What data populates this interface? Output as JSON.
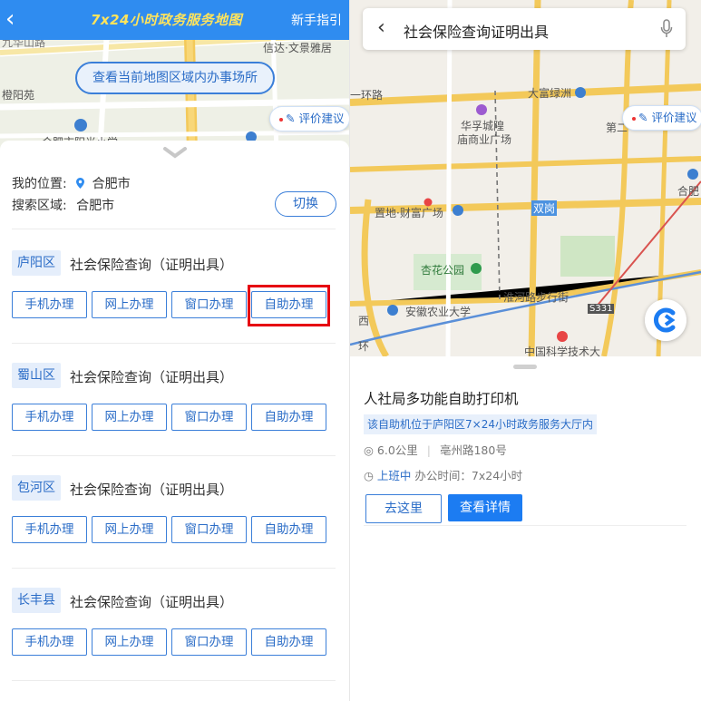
{
  "left": {
    "header": {
      "title": "7x24小时政务服务地图",
      "guide": "新手指引"
    },
    "map": {
      "labels": [
        "九华山路",
        "信达·文景雅居",
        "橙阳苑",
        "合肥市阳光小学"
      ],
      "view_offices_button": "查看当前地图区域内办事场所",
      "evaluate_button": "评价建议"
    },
    "location": {
      "my_label": "我的位置:",
      "my_value": "合肥市",
      "area_label": "搜索区域:",
      "area_value": "合肥市",
      "switch_label": "切换"
    },
    "districts": [
      {
        "name": "庐阳区",
        "service": "社会保险查询（证明出具）",
        "buttons": [
          "手机办理",
          "网上办理",
          "窗口办理",
          "自助办理"
        ]
      },
      {
        "name": "蜀山区",
        "service": "社会保险查询（证明出具）",
        "buttons": [
          "手机办理",
          "网上办理",
          "窗口办理",
          "自助办理"
        ]
      },
      {
        "name": "包河区",
        "service": "社会保险查询（证明出具）",
        "buttons": [
          "手机办理",
          "网上办理",
          "窗口办理",
          "自助办理"
        ]
      },
      {
        "name": "长丰县",
        "service": "社会保险查询（证明出具）",
        "buttons": [
          "手机办理",
          "网上办理",
          "窗口办理",
          "自助办理"
        ]
      }
    ]
  },
  "right": {
    "search": {
      "query": "社会保险查询证明出具"
    },
    "map": {
      "labels": [
        "一环路",
        "大富绿洲",
        "华孚城隍",
        "庙商业广场",
        "第二",
        "置地·财富广场",
        "双岗",
        "合肥",
        "杏花公园",
        "淮河路步行街",
        "安徽农业大学",
        "S331",
        "西",
        "环",
        "中国科学技术大"
      ],
      "evaluate_button": "评价建议"
    },
    "card": {
      "name": "人社局多功能自助打印机",
      "description": "该自助机位于庐阳区7×24小时政务服务大厅内",
      "distance": "6.0公里",
      "address": "亳州路180号",
      "status": "上班中",
      "hours": "办公时间：7x24小时",
      "goto_button": "去这里",
      "detail_button": "查看详情"
    }
  },
  "colors": {
    "brand": "#2f8cf0",
    "highlight": "#e60012",
    "title_yellow": "#ffe45c"
  }
}
